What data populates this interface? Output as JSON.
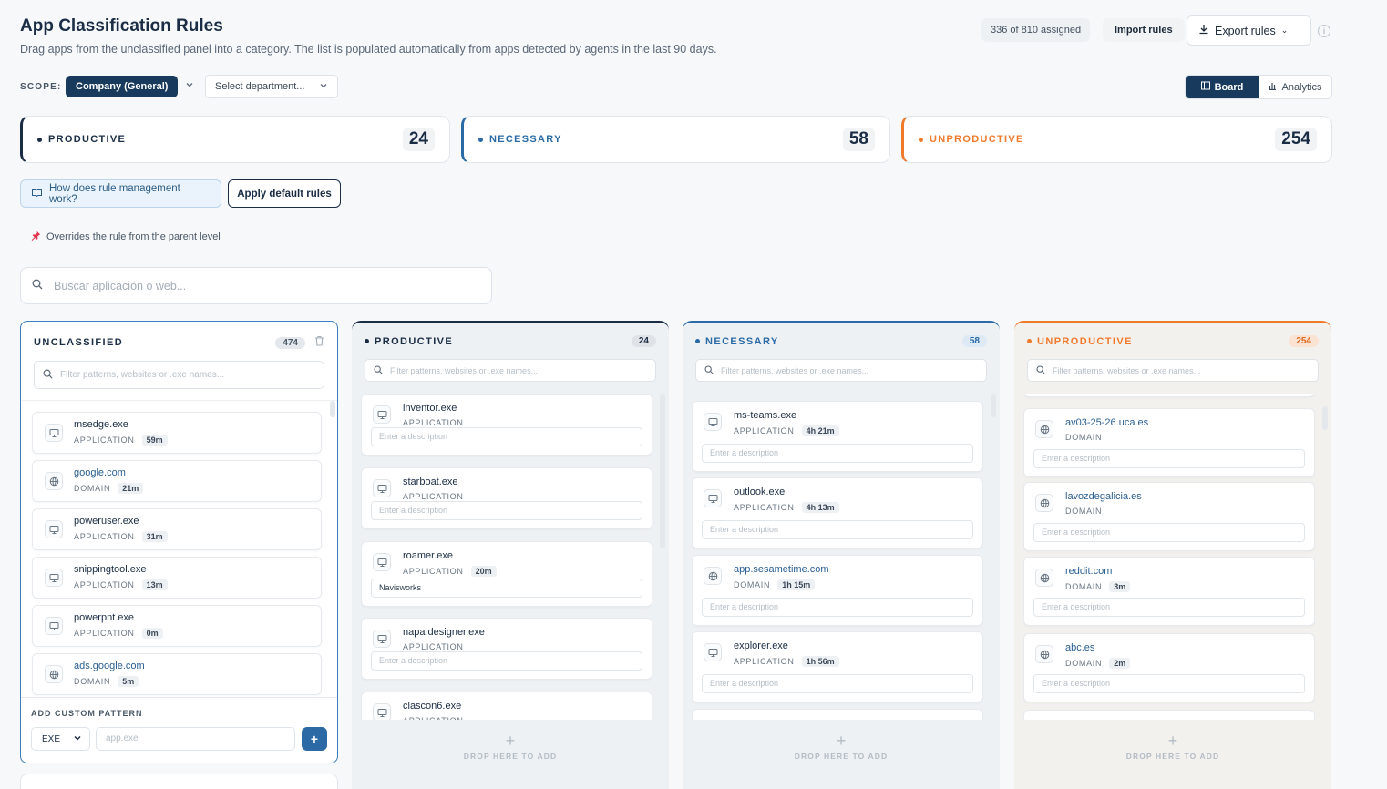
{
  "header": {
    "title": "App Classification Rules",
    "subtitle": "Drag apps from the unclassified panel into a category. The list is populated automatically from apps detected by agents in the last 90 days.",
    "assigned": "336 of 810 assigned",
    "import_label": "Import rules",
    "export_label": "Export rules"
  },
  "scope": {
    "label": "SCOPE:",
    "company": "Company (General)",
    "department_placeholder": "Select department..."
  },
  "view": {
    "board": "Board",
    "analytics": "Analytics"
  },
  "stats": [
    {
      "label": "PRODUCTIVE",
      "count": "24",
      "color": "#1a2d45"
    },
    {
      "label": "NECESSARY",
      "count": "58",
      "color": "#2a6aa6"
    },
    {
      "label": "UNPRODUCTIVE",
      "count": "254",
      "color": "#f07a2c"
    }
  ],
  "actions": {
    "help": "How does rule management work?",
    "apply_default": "Apply default rules",
    "override_note": "Overrides the rule from the parent level"
  },
  "search": {
    "placeholder": "Buscar aplicación o web..."
  },
  "unclassified": {
    "title": "UNCLASSIFIED",
    "count": "474",
    "filter_placeholder": "Filter patterns, websites or .exe names...",
    "items": [
      {
        "name": "msedge.exe",
        "type": "APPLICATION",
        "duration": "59m",
        "kind": "app"
      },
      {
        "name": "google.com",
        "type": "DOMAIN",
        "duration": "21m",
        "kind": "domain"
      },
      {
        "name": "poweruser.exe",
        "type": "APPLICATION",
        "duration": "31m",
        "kind": "app"
      },
      {
        "name": "snippingtool.exe",
        "type": "APPLICATION",
        "duration": "13m",
        "kind": "app"
      },
      {
        "name": "powerpnt.exe",
        "type": "APPLICATION",
        "duration": "0m",
        "kind": "app"
      },
      {
        "name": "ads.google.com",
        "type": "DOMAIN",
        "duration": "5m",
        "kind": "domain"
      }
    ],
    "custom": {
      "label": "ADD CUSTOM PATTERN",
      "type_value": "EXE",
      "placeholder": "app.exe",
      "add": "+"
    }
  },
  "columns": [
    {
      "title": "PRODUCTIVE",
      "count": "24",
      "color": "#1a2d45",
      "filter_placeholder": "Filter patterns, websites or .exe names...",
      "drop": "DROP HERE TO ADD",
      "items": [
        {
          "name": "inventor.exe",
          "type": "APPLICATION",
          "duration": "",
          "kind": "app",
          "desc": "Enter a description",
          "filled": false
        },
        {
          "name": "starboat.exe",
          "type": "APPLICATION",
          "duration": "",
          "kind": "app",
          "desc": "Enter a description",
          "filled": false
        },
        {
          "name": "roamer.exe",
          "type": "APPLICATION",
          "duration": "20m",
          "kind": "app",
          "desc": "Navisworks",
          "filled": true
        },
        {
          "name": "napa designer.exe",
          "type": "APPLICATION",
          "duration": "",
          "kind": "app",
          "desc": "Enter a description",
          "filled": false
        },
        {
          "name": "clascon6.exe",
          "type": "APPLICATION",
          "duration": "",
          "kind": "app",
          "desc": "",
          "filled": false
        }
      ]
    },
    {
      "title": "NECESSARY",
      "count": "58",
      "color": "#2a6aa6",
      "filter_placeholder": "Filter patterns, websites or .exe names...",
      "drop": "DROP HERE TO ADD",
      "items": [
        {
          "name": "ms-teams.exe",
          "type": "APPLICATION",
          "duration": "4h 21m",
          "kind": "app",
          "desc": "Enter a description",
          "filled": false
        },
        {
          "name": "outlook.exe",
          "type": "APPLICATION",
          "duration": "4h 13m",
          "kind": "app",
          "desc": "Enter a description",
          "filled": false
        },
        {
          "name": "app.sesametime.com",
          "type": "DOMAIN",
          "duration": "1h 15m",
          "kind": "domain",
          "desc": "Enter a description",
          "filled": false
        },
        {
          "name": "explorer.exe",
          "type": "APPLICATION",
          "duration": "1h 56m",
          "kind": "app",
          "desc": "Enter a description",
          "filled": false
        }
      ]
    },
    {
      "title": "UNPRODUCTIVE",
      "count": "254",
      "color": "#f07a2c",
      "filter_placeholder": "Filter patterns, websites or .exe names...",
      "drop": "DROP HERE TO ADD",
      "items": [
        {
          "name": "av03-25-26.uca.es",
          "type": "DOMAIN",
          "duration": "",
          "kind": "domain",
          "desc": "Enter a description",
          "filled": false
        },
        {
          "name": "lavozdegalicia.es",
          "type": "DOMAIN",
          "duration": "",
          "kind": "domain",
          "desc": "Enter a description",
          "filled": false
        },
        {
          "name": "reddit.com",
          "type": "DOMAIN",
          "duration": "3m",
          "kind": "domain",
          "desc": "Enter a description",
          "filled": false
        },
        {
          "name": "abc.es",
          "type": "DOMAIN",
          "duration": "2m",
          "kind": "domain",
          "desc": "Enter a description",
          "filled": false
        }
      ]
    }
  ]
}
